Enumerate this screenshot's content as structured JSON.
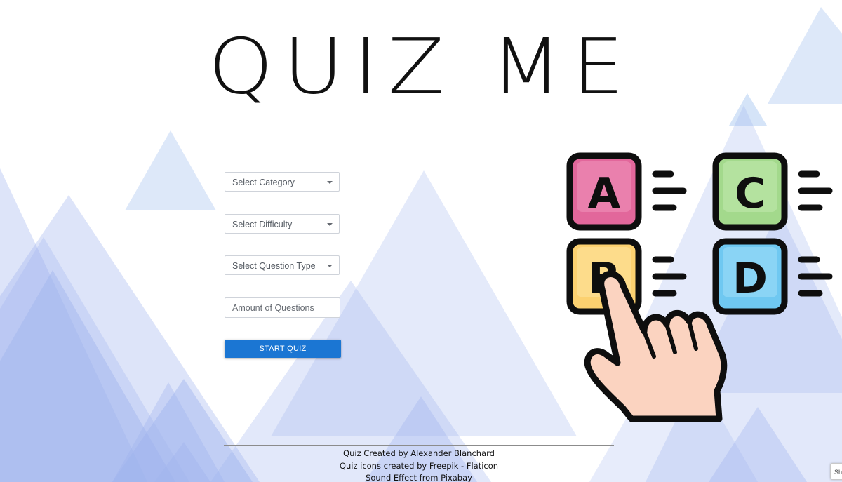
{
  "header": {
    "title": "QUIZ ME"
  },
  "form": {
    "category": {
      "label": "Select Category"
    },
    "difficulty": {
      "label": "Select Difficulty"
    },
    "question_type": {
      "label": "Select Question Type"
    },
    "amount": {
      "placeholder": "Amount of Questions",
      "value": ""
    },
    "start_label": "START QUIZ"
  },
  "illustration": {
    "name": "quiz-answer-icon",
    "letters": [
      "A",
      "C",
      "B",
      "D"
    ],
    "colors": {
      "a": "#e2679b",
      "b": "#fcd170",
      "c": "#a3d98c",
      "d": "#6fc8f1",
      "hand": "#fbd3c0",
      "outline": "#0e0e0e"
    }
  },
  "footer": {
    "lines": [
      "Quiz Created by Alexander Blanchard",
      "Quiz icons created by Freepik - Flaticon",
      "Sound Effect from Pixabay"
    ]
  },
  "corner_button": {
    "label": "Sh"
  },
  "colors": {
    "primary": "#1b76d3",
    "background_triangles": "#a9b9ee"
  }
}
